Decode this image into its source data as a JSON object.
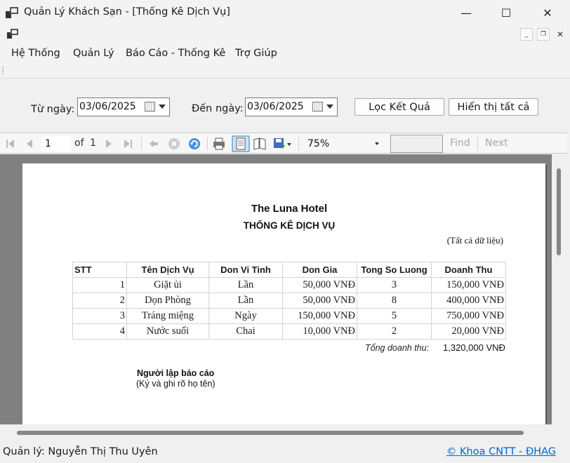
{
  "window": {
    "title": "Quản Lý Khách Sạn - [Thống Kê Dịch Vụ]",
    "minimize": "—",
    "maximize": "☐",
    "close": "✕",
    "mdi_minimize": "_",
    "mdi_restore": "❐",
    "mdi_close": "✕"
  },
  "menu": [
    "Hệ Thống",
    "Quản Lý",
    "Báo Cáo - Thống Kê",
    "Trợ Giúp"
  ],
  "filter": {
    "from_label": "Từ ngày:",
    "from_value": "03/06/2025",
    "to_label": "Đến ngày:",
    "to_value": "03/06/2025",
    "filter_button": "Lọc Kết Quả",
    "show_all_button": "Hiển thị tất cả"
  },
  "report_toolbar": {
    "page": "1",
    "of_label": "of",
    "total_pages": "1",
    "zoom": "75%",
    "find_label": "Find",
    "next_label": "Next"
  },
  "report": {
    "hotel": "The Luna Hotel",
    "title": "THỐNG KÊ DỊCH VỤ",
    "note": "(Tất cả dữ liệu)",
    "columns": [
      "STT",
      "Tên Dịch Vụ",
      "Don Vi Tinh",
      "Don Gia",
      "Tong So Luong",
      "Doanh Thu"
    ],
    "rows": [
      [
        "1",
        "Giặt ủi",
        "Lần",
        "50,000 VNĐ",
        "3",
        "150,000 VNĐ"
      ],
      [
        "2",
        "Dọn Phòng",
        "Lần",
        "50,000 VNĐ",
        "8",
        "400,000 VNĐ"
      ],
      [
        "3",
        "Tráng miệng",
        "Ngày",
        "150,000 VNĐ",
        "5",
        "750,000 VNĐ"
      ],
      [
        "4",
        "Nước suối",
        "Chai",
        "10,000 VNĐ",
        "2",
        "20,000 VNĐ"
      ]
    ],
    "total_label": "Tổng doanh thu:",
    "total_value": "1,320,000 VNĐ",
    "signer_title": "Người lập báo cáo",
    "signer_note": "(Ký và ghi rõ họ tên)"
  },
  "status": {
    "manager": "Quản lý: Nguyễn Thị Thu Uyên",
    "copyright": "© Khoa CNTT - ĐHAG"
  },
  "colors": {
    "link": "#0066cc",
    "viewer_bg": "#808080"
  }
}
